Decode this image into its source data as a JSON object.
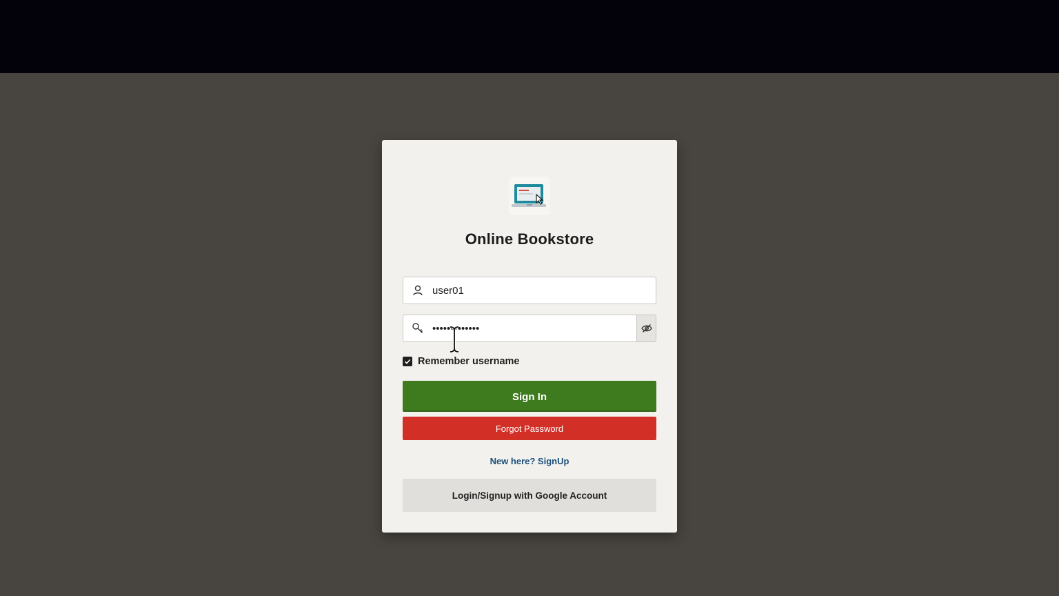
{
  "app": {
    "title": "Online Bookstore",
    "logo_icon": "laptop-cursor-icon"
  },
  "form": {
    "username": {
      "value": "user01",
      "icon": "user-icon"
    },
    "password": {
      "value": "•••••••••••••",
      "icon": "key-icon",
      "reveal_icon": "eye-slash-icon"
    },
    "remember": {
      "label": "Remember username",
      "checked": true
    }
  },
  "buttons": {
    "sign_in": "Sign In",
    "forgot_password": "Forgot Password",
    "google": "Login/Signup with Google Account"
  },
  "links": {
    "signup": "New here? SignUp"
  },
  "colors": {
    "background": "#48443f",
    "top_bar": "#03020a",
    "card": "#f2f1ee",
    "sign_in": "#3e7a1e",
    "forgot_password": "#d22f27",
    "link": "#1b4f7a",
    "google_button": "#e0dfdc"
  }
}
